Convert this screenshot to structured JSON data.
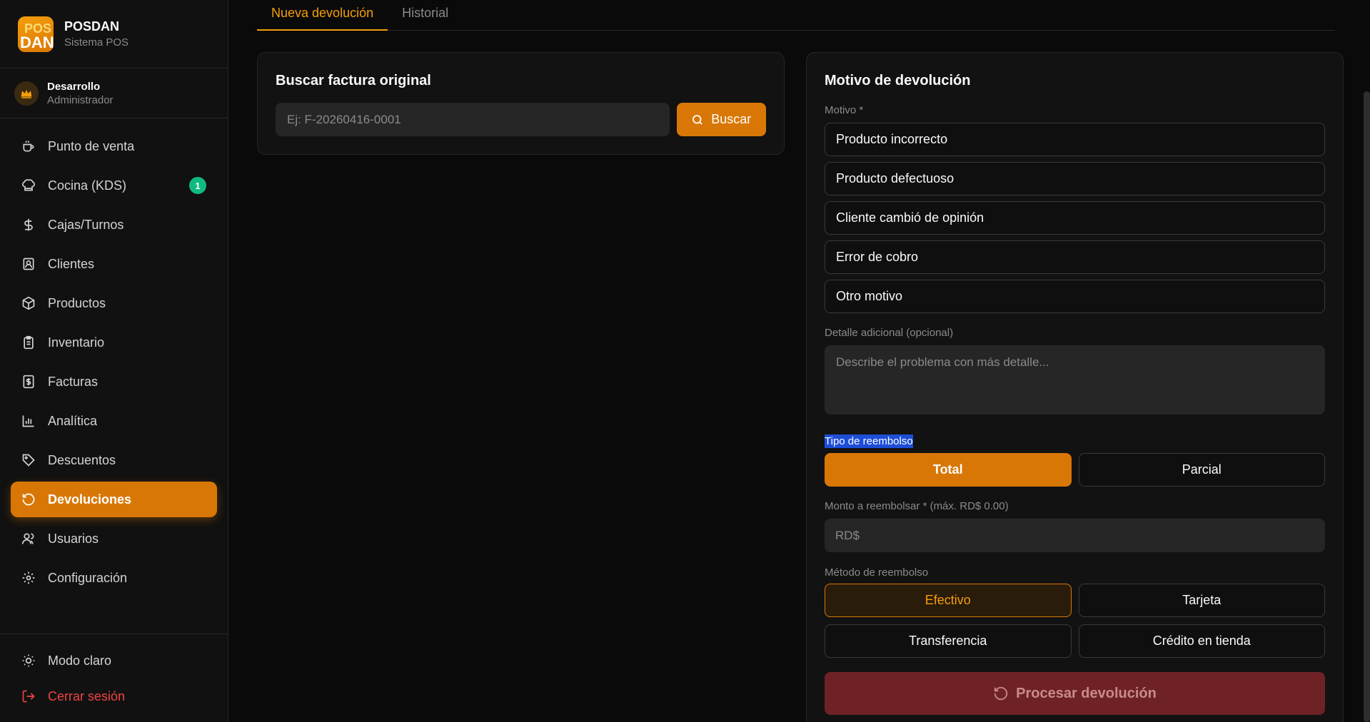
{
  "brand": {
    "title": "POSDAN",
    "subtitle": "Sistema POS",
    "logo_top": "POS",
    "logo_bottom": "DAN"
  },
  "user": {
    "name": "Desarrollo",
    "role": "Administrador"
  },
  "nav": [
    {
      "label": "Punto de venta",
      "icon": "coffee-cup-icon"
    },
    {
      "label": "Cocina (KDS)",
      "icon": "chef-hat-icon",
      "badge": "1"
    },
    {
      "label": "Cajas/Turnos",
      "icon": "dollar-icon"
    },
    {
      "label": "Clientes",
      "icon": "contact-icon"
    },
    {
      "label": "Productos",
      "icon": "package-icon"
    },
    {
      "label": "Inventario",
      "icon": "clipboard-icon"
    },
    {
      "label": "Facturas",
      "icon": "receipt-icon"
    },
    {
      "label": "Analítica",
      "icon": "bar-chart-icon"
    },
    {
      "label": "Descuentos",
      "icon": "tag-icon"
    },
    {
      "label": "Devoluciones",
      "icon": "rotate-ccw-icon",
      "active": true
    },
    {
      "label": "Usuarios",
      "icon": "users-icon"
    },
    {
      "label": "Configuración",
      "icon": "gear-icon"
    }
  ],
  "footer": {
    "theme": "Modo claro",
    "logout": "Cerrar sesión"
  },
  "tabs": {
    "new": "Nueva devolución",
    "history": "Historial"
  },
  "search": {
    "title": "Buscar factura original",
    "placeholder": "Ej: F-20260416-0001",
    "button": "Buscar"
  },
  "reason": {
    "title": "Motivo de devolución",
    "motivo_label": "Motivo *",
    "options": [
      "Producto incorrecto",
      "Producto defectuoso",
      "Cliente cambió de opinión",
      "Error de cobro",
      "Otro motivo"
    ],
    "detail_label": "Detalle adicional (opcional)",
    "detail_placeholder": "Describe el problema con más detalle..."
  },
  "refund": {
    "type_label": "Tipo de reembolso",
    "type_total": "Total",
    "type_partial": "Parcial",
    "amount_label": "Monto a reembolsar * (máx. RD$ 0.00)",
    "amount_placeholder": "RD$",
    "method_label": "Método de reembolso",
    "methods": [
      "Efectivo",
      "Tarjeta",
      "Transferencia",
      "Crédito en tienda"
    ],
    "process_button": "Procesar devolución"
  },
  "colors": {
    "accent": "#d97706",
    "badge": "#10b981",
    "danger": "#ef4444",
    "disabled_danger": "#6f2225"
  }
}
